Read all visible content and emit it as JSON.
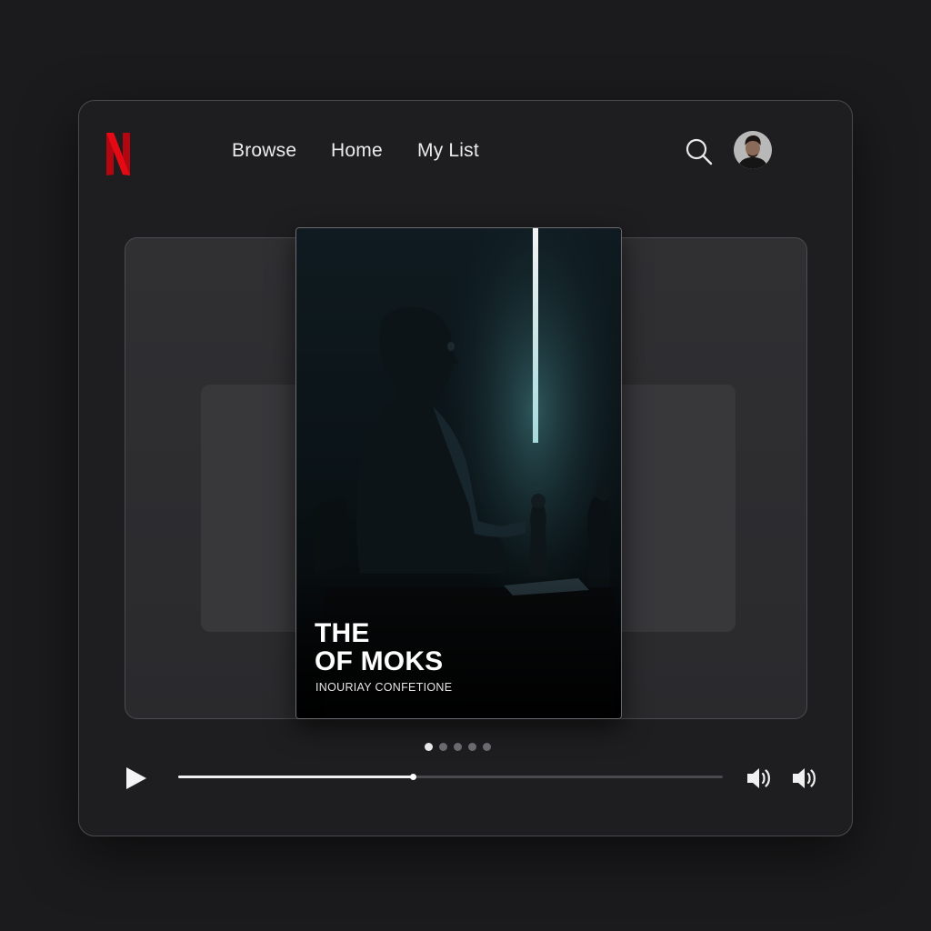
{
  "brand": {
    "logo_letter": "N",
    "logo_color": "#e50914"
  },
  "nav": {
    "items": [
      {
        "label": "Browse"
      },
      {
        "label": "Home"
      },
      {
        "label": "My List"
      }
    ]
  },
  "header": {
    "search_icon": "search-icon",
    "avatar_icon": "avatar"
  },
  "poster": {
    "title_line1": "THE",
    "title_line2": "OF MOKS",
    "subtitle": "INOURIAY CONFETIONE"
  },
  "carousel": {
    "total": 5,
    "active": 0
  },
  "player": {
    "progress": 0.43,
    "play_icon": "play-icon",
    "volume_icons": [
      "volume-icon",
      "volume-icon"
    ]
  },
  "colors": {
    "background": "#1b1b1d",
    "accent": "#e50914",
    "text": "#ececec"
  }
}
